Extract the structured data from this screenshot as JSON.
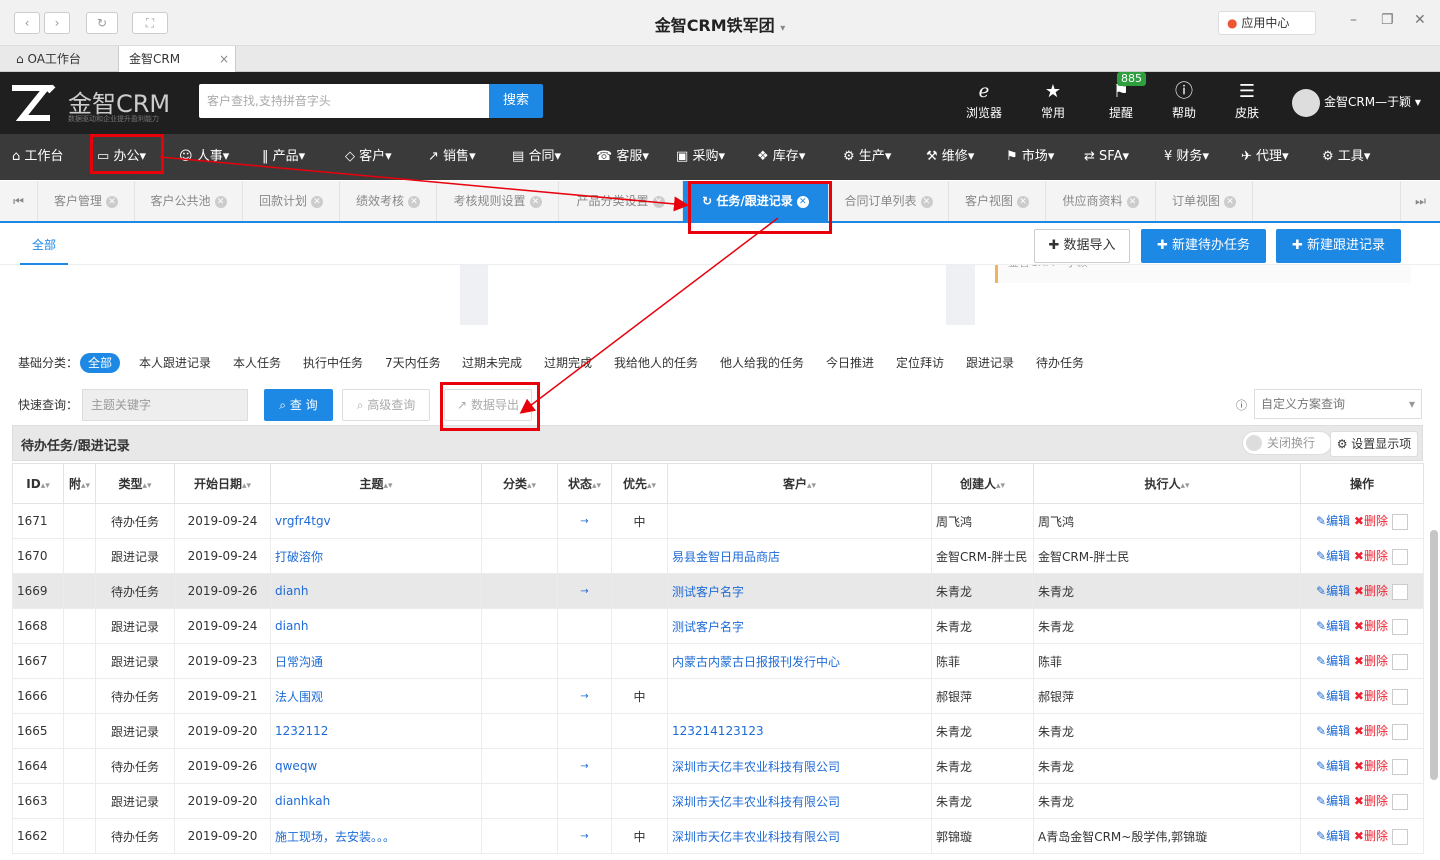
{
  "window": {
    "title": "金智CRM铁军团",
    "app_center": "应用中心"
  },
  "browser_tabs": [
    {
      "label": "OA工作台"
    },
    {
      "label": "金智CRM",
      "close": "×"
    }
  ],
  "header": {
    "logo_text": "金智CRM",
    "logo_sub": "数据驱动和企业提升盈利能力",
    "search_placeholder": "客户查找,支持拼音字头",
    "search_button": "搜索",
    "icons": [
      {
        "label": "浏览器"
      },
      {
        "label": "常用"
      },
      {
        "label": "提醒"
      },
      {
        "label": "帮助"
      },
      {
        "label": "皮肤"
      }
    ],
    "reminder_badge": "885",
    "user": "金智CRM—于颖"
  },
  "menu": [
    {
      "label": "工作台"
    },
    {
      "label": "办公"
    },
    {
      "label": "人事"
    },
    {
      "label": "产品"
    },
    {
      "label": "客户"
    },
    {
      "label": "销售"
    },
    {
      "label": "合同"
    },
    {
      "label": "客服"
    },
    {
      "label": "采购"
    },
    {
      "label": "库存"
    },
    {
      "label": "生产"
    },
    {
      "label": "维修"
    },
    {
      "label": "市场"
    },
    {
      "label": "SFA"
    },
    {
      "label": "财务"
    },
    {
      "label": "代理"
    },
    {
      "label": "工具"
    }
  ],
  "page_tabs": [
    {
      "label": "客户管理"
    },
    {
      "label": "客户公共池"
    },
    {
      "label": "回款计划"
    },
    {
      "label": "绩效考核"
    },
    {
      "label": "考核规则设置"
    },
    {
      "label": "产品分类设置"
    },
    {
      "label": "任务/跟进记录"
    },
    {
      "label": "合同订单列表"
    },
    {
      "label": "客户视图"
    },
    {
      "label": "供应商资料"
    },
    {
      "label": "订单视图"
    }
  ],
  "top": {
    "subtab": "全部",
    "import_button": "数据导入",
    "new_task_button": "新建待办任务",
    "new_follow_button": "新建跟进记录",
    "panel_text": "金智CRM—于颖"
  },
  "filters": {
    "label": "基础分类：",
    "items": [
      "全部",
      "本人跟进记录",
      "本人任务",
      "执行中任务",
      "7天内任务",
      "过期未完成",
      "过期完成",
      "我给他人的任务",
      "他人给我的任务",
      "今日推进",
      "定位拜访",
      "跟进记录",
      "待办任务"
    ]
  },
  "quick": {
    "label": "快速查询：",
    "placeholder": "主题关键字",
    "query_button": "查 询",
    "advanced_button": "高级查询",
    "export_button": "数据导出",
    "schema_placeholder": "自定义方案查询"
  },
  "grid": {
    "title": "待办任务/跟进记录",
    "wrap_toggle": "关闭换行",
    "columns_button": "设置显示项",
    "headers": [
      "ID",
      "附",
      "类型",
      "开始日期",
      "主题",
      "分类",
      "状态",
      "优先",
      "客户",
      "创建人",
      "执行人",
      "操作"
    ],
    "edit": "编辑",
    "delete": "删除",
    "rows": [
      {
        "id": "1671",
        "type": "待办任务",
        "date": "2019-09-24",
        "subject": "vrgfr4tgv",
        "status": "→",
        "priority": "中",
        "customer": "",
        "creator": "周飞鸿",
        "executor": "周飞鸿"
      },
      {
        "id": "1670",
        "type": "跟进记录",
        "date": "2019-09-24",
        "subject": "打破溶你",
        "status": "",
        "priority": "",
        "customer": "易县金智日用品商店",
        "creator": "金智CRM-胖士民",
        "executor": "金智CRM-胖士民"
      },
      {
        "id": "1669",
        "type": "待办任务",
        "date": "2019-09-26",
        "subject": "dianh",
        "status": "→",
        "priority": "",
        "customer": "测试客户名字",
        "creator": "朱青龙",
        "executor": "朱青龙"
      },
      {
        "id": "1668",
        "type": "跟进记录",
        "date": "2019-09-24",
        "subject": "dianh",
        "status": "",
        "priority": "",
        "customer": "测试客户名字",
        "creator": "朱青龙",
        "executor": "朱青龙"
      },
      {
        "id": "1667",
        "type": "跟进记录",
        "date": "2019-09-23",
        "subject": "日常沟通",
        "status": "",
        "priority": "",
        "customer": "内蒙古内蒙古日报报刊发行中心",
        "creator": "陈菲",
        "executor": "陈菲"
      },
      {
        "id": "1666",
        "type": "待办任务",
        "date": "2019-09-21",
        "subject": "法人围观",
        "status": "→",
        "priority": "中",
        "customer": "",
        "creator": "郝银萍",
        "executor": "郝银萍"
      },
      {
        "id": "1665",
        "type": "跟进记录",
        "date": "2019-09-20",
        "subject": "1232112",
        "status": "",
        "priority": "",
        "customer": "123214123123",
        "creator": "朱青龙",
        "executor": "朱青龙"
      },
      {
        "id": "1664",
        "type": "待办任务",
        "date": "2019-09-26",
        "subject": "qweqw",
        "status": "→",
        "priority": "",
        "customer": "深圳市天亿丰农业科技有限公司",
        "creator": "朱青龙",
        "executor": "朱青龙"
      },
      {
        "id": "1663",
        "type": "跟进记录",
        "date": "2019-09-20",
        "subject": "dianhkah",
        "status": "",
        "priority": "",
        "customer": "深圳市天亿丰农业科技有限公司",
        "creator": "朱青龙",
        "executor": "朱青龙"
      },
      {
        "id": "1662",
        "type": "待办任务",
        "date": "2019-09-20",
        "subject": "施工现场，去安装。。。",
        "status": "→",
        "priority": "中",
        "customer": "深圳市天亿丰农业科技有限公司",
        "creator": "郭锦璇",
        "executor": "A青岛金智CRM~殷学伟,郭锦璇"
      }
    ]
  },
  "colors": {
    "accent": "#1e88e5",
    "header": "#1f1f1f",
    "menu": "#3a3a3a",
    "highlight": "#e8000b"
  }
}
